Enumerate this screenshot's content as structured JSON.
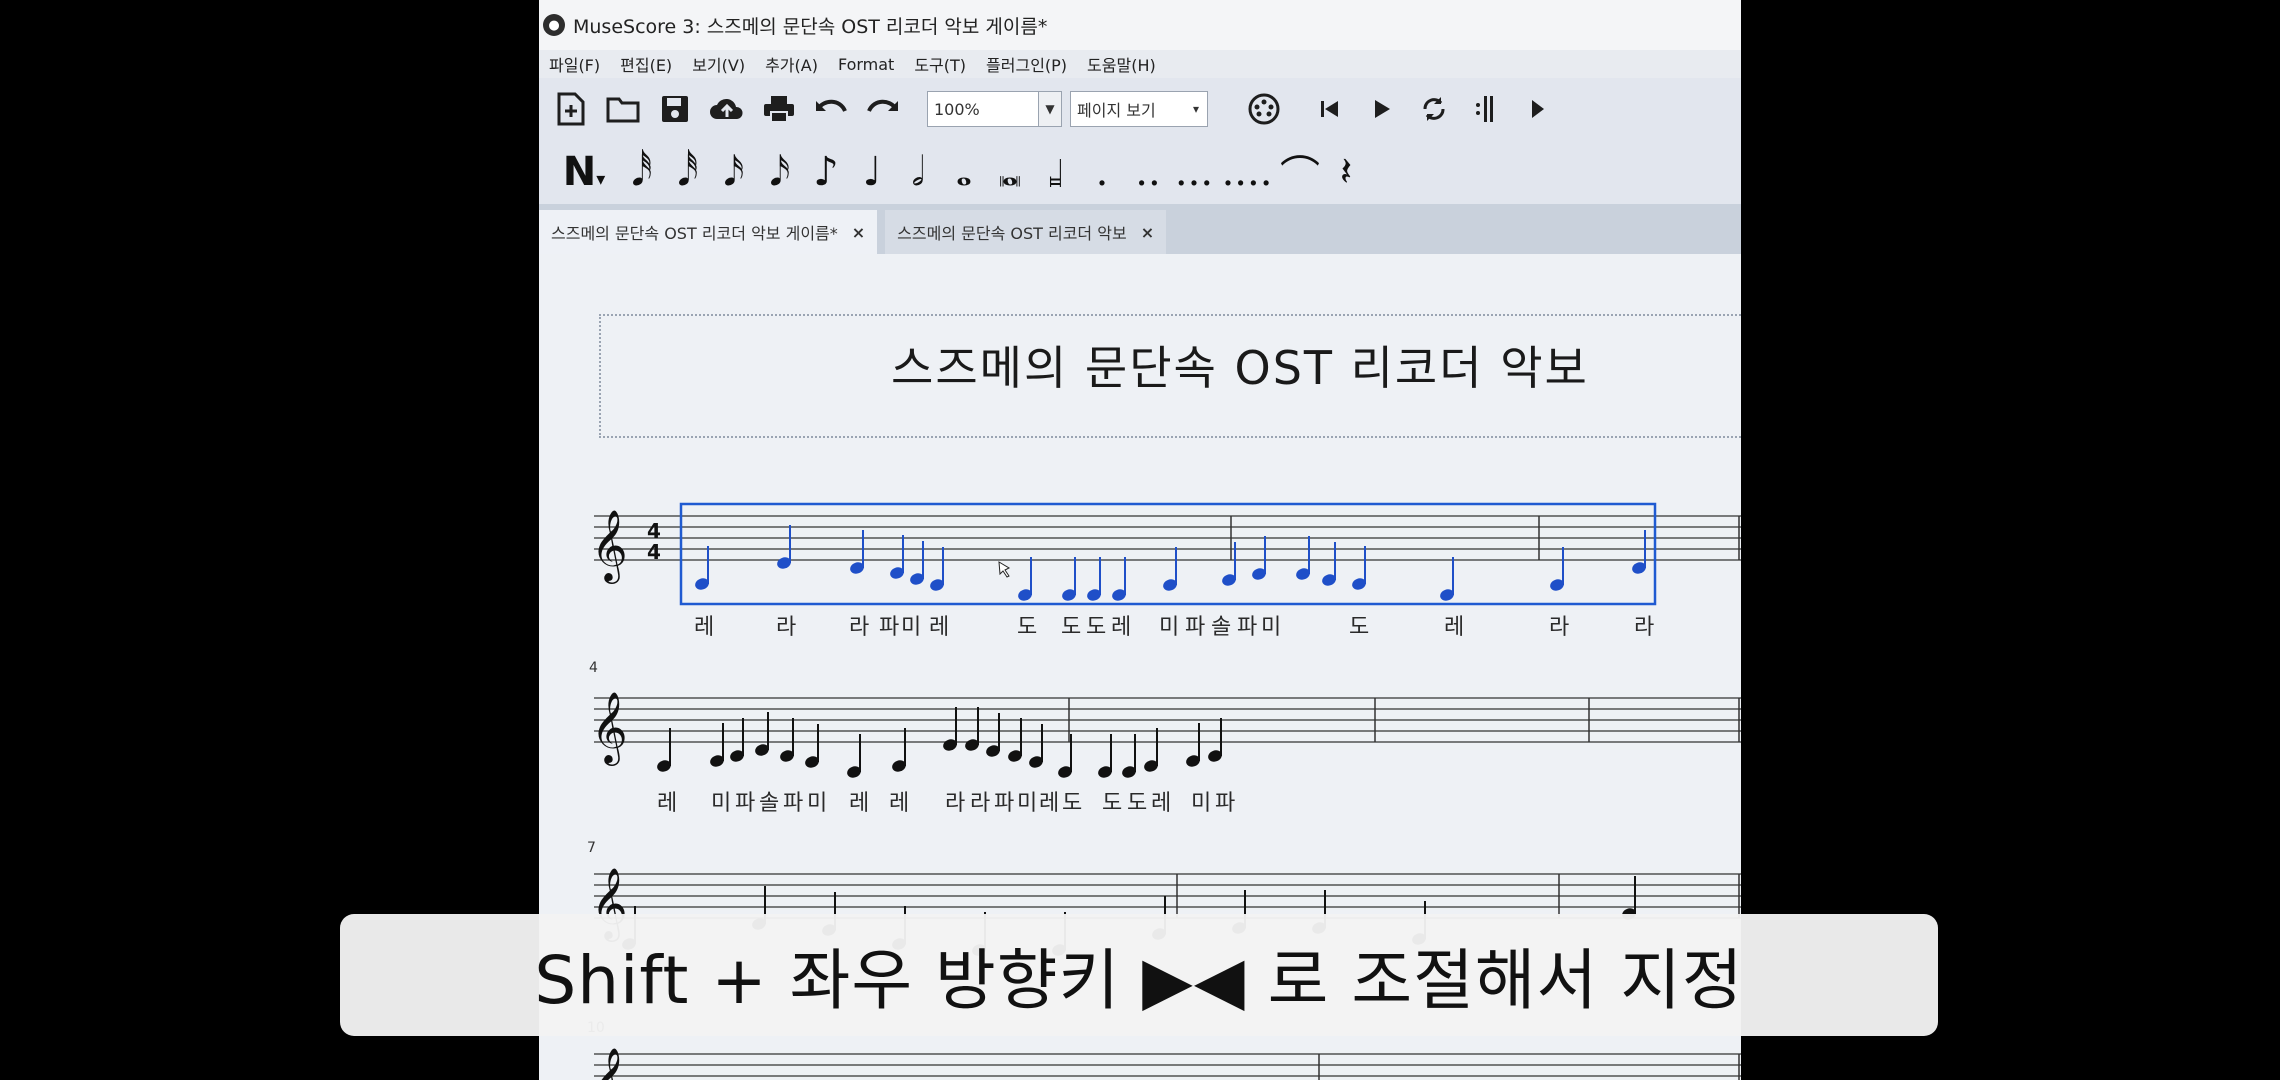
{
  "window": {
    "title": "MuseScore 3: 스즈메의 문단속 OST 리코더 악보 게이름*"
  },
  "menu": [
    "파일(F)",
    "편집(E)",
    "보기(V)",
    "추가(A)",
    "Format",
    "도구(T)",
    "플러그인(P)",
    "도움말(H)"
  ],
  "toolbar": {
    "zoom_value": "100%",
    "view_mode": "페이지 보기"
  },
  "tabs": [
    {
      "label": "스즈메의 문단속 OST 리코더 악보 게이름*",
      "close": "×"
    },
    {
      "label": "스즈메의 문단속 OST 리코더 악보",
      "close": "×"
    }
  ],
  "score": {
    "title": "스즈메의 문단속 OST 리코더 악보",
    "measure_numbers": [
      "4",
      "7",
      "10"
    ],
    "lyrics_line1": [
      "레",
      "라",
      "라",
      "파",
      "미",
      "레",
      "도",
      "도",
      "도",
      "레",
      "미",
      "파",
      "솔",
      "파",
      "미",
      "도",
      "레",
      "라",
      "라"
    ],
    "lyrics_line2": [
      "레",
      "미",
      "파",
      "솔",
      "파",
      "미",
      "레",
      "레",
      "라",
      "라",
      "파",
      "미",
      "레",
      "도",
      "도",
      "도",
      "레",
      "미",
      "파"
    ]
  },
  "caption": {
    "text": "Shift + 좌우 방향키 ▶◀ 로 조절해서 지정"
  },
  "colors": {
    "selection": "#1f5ad1",
    "note": "#111111",
    "selected_note": "#1f4fc8"
  }
}
